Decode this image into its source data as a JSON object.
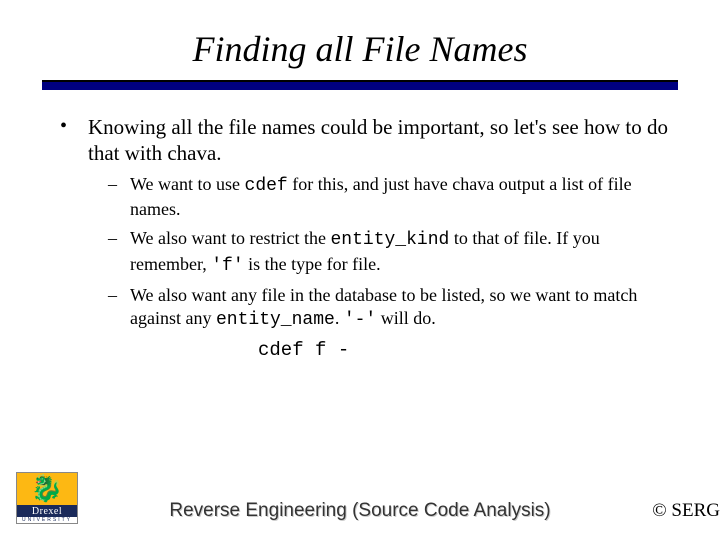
{
  "title": "Finding all File Names",
  "bullet1": "Knowing all the file names could be important, so let's see how to do that with chava.",
  "sub1_a": "We want to use ",
  "sub1_code": "cdef",
  "sub1_b": " for this, and just have chava output a list of file names.",
  "sub2_a": "We also want to restrict the ",
  "sub2_code": "entity_kind",
  "sub2_b": " to that of file.  If you remember, ",
  "sub2_code2": "'f'",
  "sub2_c": " is the type for file.",
  "sub3_a": "We also want any file in the database to be listed, so we want to match against any ",
  "sub3_code": "entity_name",
  "sub3_b": ".  ",
  "sub3_code2": "'-'",
  "sub3_c": " will do.",
  "command": "cdef f -",
  "logo_name": "Drexel",
  "logo_sub": "UNIVERSITY",
  "footer_title": "Reverse Engineering (Source Code Analysis)",
  "copyright": "© SERG"
}
